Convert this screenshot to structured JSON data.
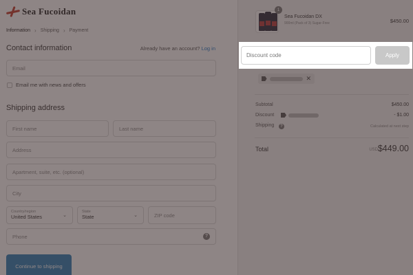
{
  "brand": {
    "logo_text": "Sea Fucoidan"
  },
  "breadcrumb": {
    "information": "Information",
    "shipping": "Shipping",
    "payment": "Payment"
  },
  "contact": {
    "title": "Contact information",
    "login_prompt": "Already have an account?",
    "login_link": "Log in",
    "email_placeholder": "Email",
    "newsletter_label": "Email me with news and offers"
  },
  "shipping": {
    "title": "Shipping address",
    "first_name": "First name",
    "last_name": "Last name",
    "address": "Address",
    "apartment": "Apartment, suite, etc. (optional)",
    "city": "City",
    "country_label": "Country/region",
    "country_value": "United States",
    "state_label": "State",
    "state_value": "State",
    "zip": "ZIP code",
    "phone": "Phone"
  },
  "continue_label": "Continue to shipping",
  "product": {
    "name": "Sea Fucoidan DX",
    "variant": "900ml (Pack of 3) Sugar-Free",
    "price": "$450.00",
    "quantity": "1"
  },
  "discount": {
    "placeholder": "Discount code",
    "apply_label": "Apply"
  },
  "summary": {
    "subtotal_label": "Subtotal",
    "subtotal_value": "$450.00",
    "discount_label": "Discount",
    "discount_value": "- $1.00",
    "shipping_label": "Shipping",
    "shipping_value": "Calculated at next step",
    "total_label": "Total",
    "currency": "USD",
    "total_value": "$449.00"
  },
  "colors": {
    "accent": "#2176c7",
    "button": "#2c7fb8",
    "overlay": "#3c2d2d"
  }
}
